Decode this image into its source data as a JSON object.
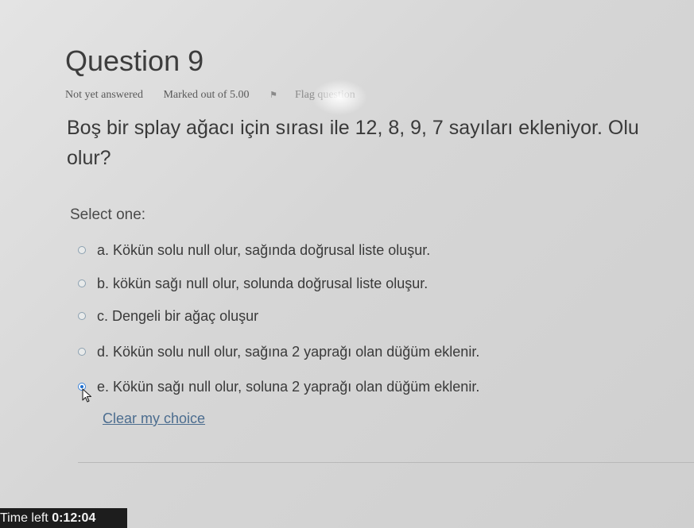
{
  "question": {
    "title": "Question 9",
    "status": "Not yet answered",
    "marked_out_of": "Marked out of 5.00",
    "flag_label": "Flag question",
    "text_line1": "Boş bir splay ağacı için sırası ile 12, 8, 9, 7 sayıları ekleniyor. Olu",
    "text_line2": "olur?"
  },
  "answer": {
    "select_label": "Select one:",
    "options": [
      {
        "label": "a. Kökün solu null olur, sağında doğrusal liste oluşur.",
        "selected": false
      },
      {
        "label": "b. kökün sağı null olur, solunda doğrusal liste oluşur.",
        "selected": false
      },
      {
        "label": "c. Dengeli bir ağaç oluşur",
        "selected": false
      },
      {
        "label": "d. Kökün solu null olur, sağına 2 yaprağı olan düğüm eklenir.",
        "selected": false
      },
      {
        "label": "e. Kökün sağı null olur, soluna 2 yaprağı olan düğüm eklenir.",
        "selected": true
      }
    ],
    "clear_label": "Clear my choice"
  },
  "timer": {
    "label": "Time left",
    "value": "0:12:04"
  },
  "icons": {
    "flag": "flag-icon",
    "cursor": "mouse-pointer-icon"
  },
  "colors": {
    "selected_radio": "#1e6fd0",
    "link": "#4c6d8f",
    "timer_bg": "#1d1d1d"
  }
}
